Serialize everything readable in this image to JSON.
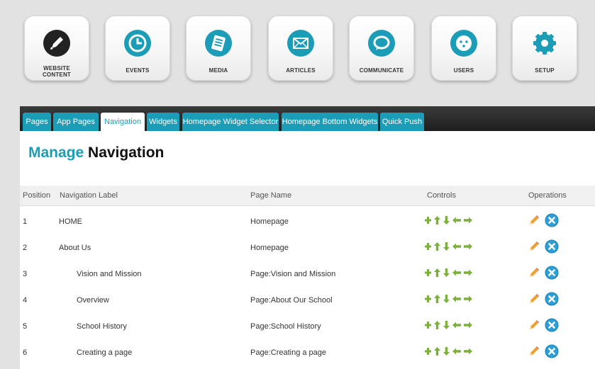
{
  "topnav": [
    {
      "label_lines": [
        "WEBSITE",
        "CONTENT"
      ],
      "icon": "pen-icon"
    },
    {
      "label_lines": [
        "EVENTS"
      ],
      "icon": "clock-icon"
    },
    {
      "label_lines": [
        "MEDIA"
      ],
      "icon": "document-icon"
    },
    {
      "label_lines": [
        "ARTICLES"
      ],
      "icon": "envelope-icon"
    },
    {
      "label_lines": [
        "COMMUNICATE"
      ],
      "icon": "speech-bubble-icon"
    },
    {
      "label_lines": [
        "USERS"
      ],
      "icon": "face-icon"
    },
    {
      "label_lines": [
        "SETUP"
      ],
      "icon": "gear-icon"
    }
  ],
  "tabs": [
    {
      "label": "Pages",
      "active": false
    },
    {
      "label": "App Pages",
      "active": false
    },
    {
      "label": "Navigation",
      "active": true
    },
    {
      "label": "Widgets",
      "active": false
    },
    {
      "label": "Homepage Widget Selector",
      "active": false
    },
    {
      "label": "Homepage Bottom Widgets",
      "active": false
    },
    {
      "label": "Quick Push",
      "active": false
    }
  ],
  "heading": {
    "accent": "Manage",
    "rest": " Navigation"
  },
  "table": {
    "columns": [
      "Position",
      "Navigation Label",
      "Page Name",
      "Controls",
      "Operations"
    ],
    "rows": [
      {
        "position": "1",
        "label": "HOME",
        "page": "Homepage",
        "indent": false
      },
      {
        "position": "2",
        "label": "About Us",
        "page": "Homepage",
        "indent": false
      },
      {
        "position": "3",
        "label": "Vision and Mission",
        "page": "Page:Vision and Mission",
        "indent": true
      },
      {
        "position": "4",
        "label": "Overview",
        "page": "Page:About Our School",
        "indent": true
      },
      {
        "position": "5",
        "label": "School History",
        "page": "Page:School History",
        "indent": true
      },
      {
        "position": "6",
        "label": "Creating a page",
        "page": "Page:Creating a page",
        "indent": true
      }
    ]
  },
  "colors": {
    "accent": "#1b9db8",
    "control_green": "#7bb13a",
    "edit_orange": "#f0a030",
    "delete_blue": "#2b9fd6"
  }
}
